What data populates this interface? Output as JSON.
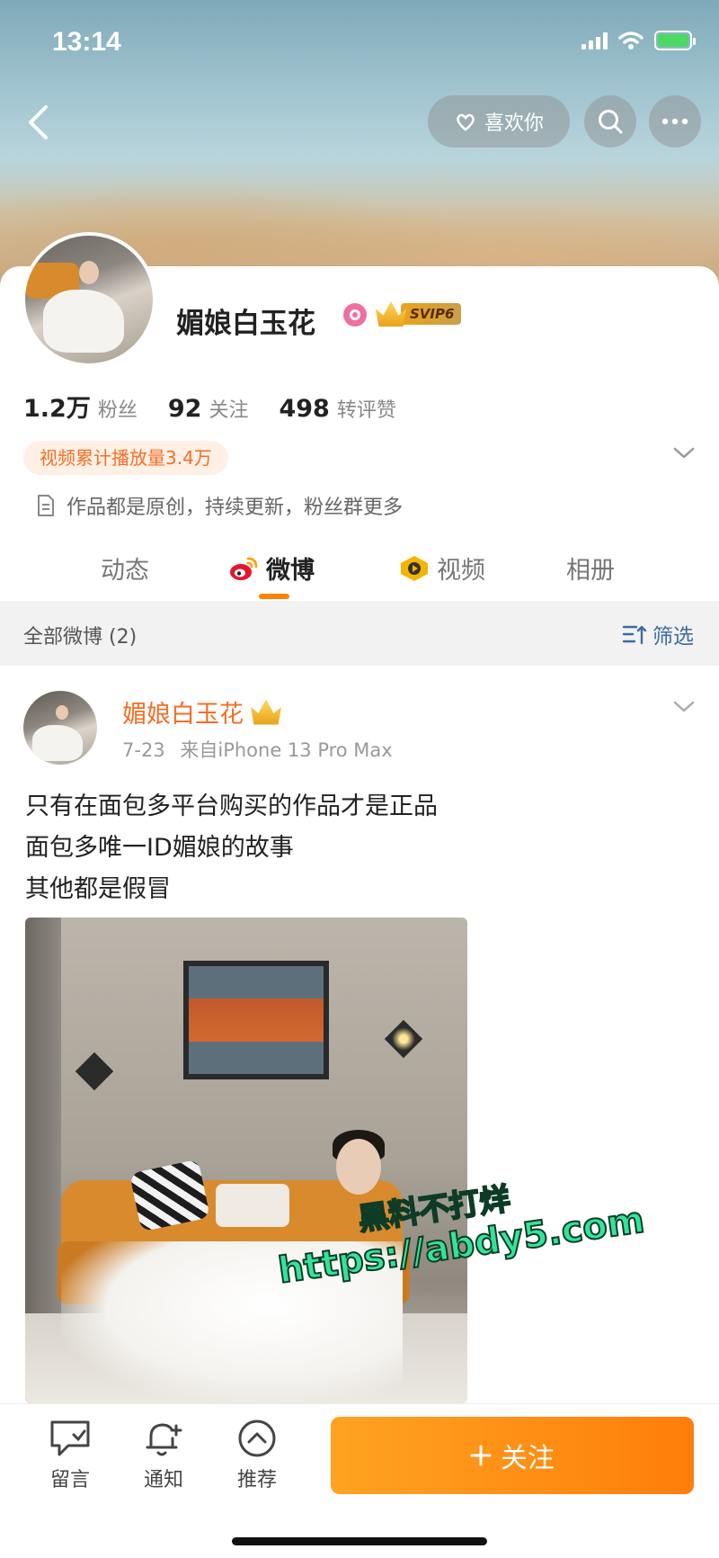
{
  "status_bar": {
    "time": "13:14"
  },
  "nav": {
    "like_label": "喜欢你"
  },
  "profile": {
    "name": "媚娘白玉花",
    "svip_label": "SVIP6",
    "stats": [
      {
        "num": "1.2万",
        "label": "粉丝"
      },
      {
        "num": "92",
        "label": "关注"
      },
      {
        "num": "498",
        "label": "转评赞"
      }
    ],
    "video_tag": "视频累计播放量3.4万",
    "bio": "作品都是原创，持续更新，粉丝群更多"
  },
  "tabs": [
    {
      "label": "动态",
      "icon": "none"
    },
    {
      "label": "微博",
      "icon": "weibo-icon"
    },
    {
      "label": "视频",
      "icon": "video-icon"
    },
    {
      "label": "相册",
      "icon": "none"
    }
  ],
  "filter": {
    "left": "全部微博 (2)",
    "right": "筛选"
  },
  "post": {
    "author": "媚娘白玉花",
    "date": "7-23",
    "source": "来自iPhone 13 Pro Max",
    "lines": [
      "只有在面包多平台购买的作品才是正品",
      "面包多唯一ID媚娘的故事",
      "其他都是假冒"
    ]
  },
  "watermark": {
    "line1": "黑料不打烊",
    "line2": "https://abdy5.com"
  },
  "bottom_bar": {
    "items": [
      {
        "label": "留言",
        "icon": "message-icon"
      },
      {
        "label": "通知",
        "icon": "bell-plus-icon"
      },
      {
        "label": "推荐",
        "icon": "recommend-icon"
      }
    ],
    "follow_label": "关注"
  },
  "colors": {
    "accent": "#ff8200",
    "follow_gradient_start": "#ffa321",
    "follow_gradient_end": "#ff7e0a",
    "link_blue": "#3c6c9f"
  }
}
